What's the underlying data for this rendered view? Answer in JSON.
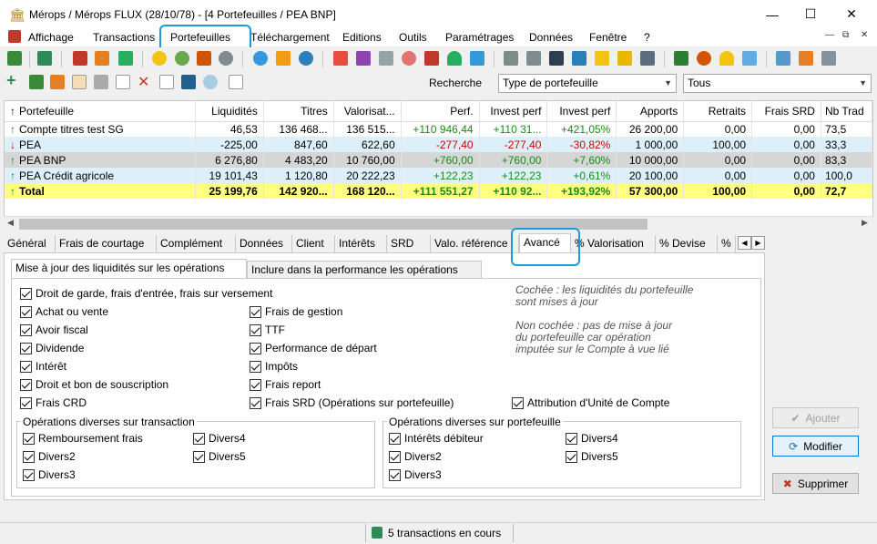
{
  "window": {
    "title": "Mérops / Mérops FLUX (28/10/78) - [4 Portefeuilles / PEA BNP]",
    "minimize": "—",
    "maximize": "☐",
    "close": "✕"
  },
  "menu": {
    "items": [
      "Affichage",
      "Transactions",
      "Portefeuilles",
      "Téléchargement",
      "Editions",
      "Outils",
      "Paramétrages",
      "Données",
      "Fenêtre",
      "?"
    ],
    "active": "Portefeuilles"
  },
  "mdi_controls": [
    "—",
    "⧉",
    "✕"
  ],
  "search": {
    "label": "Recherche",
    "type_value": "Type de portefeuille",
    "filter_value": "Tous"
  },
  "grid": {
    "columns": [
      "Portefeuille",
      "Liquidités",
      "Titres",
      "Valorisat...",
      "Perf.",
      "Invest perf",
      "Invest perf",
      "Apports",
      "Retraits",
      "Frais SRD",
      "Nb Trad"
    ],
    "rows": [
      {
        "arrow": "up",
        "style": "white",
        "cells": [
          "Compte titres test SG",
          "46,53",
          "136 468...",
          "136 515...",
          "+110 946,44",
          "+110 31...",
          "+421,05%",
          "26 200,00",
          "0,00",
          "0,00",
          "73,5"
        ]
      },
      {
        "arrow": "down",
        "style": "blue",
        "cells": [
          "PEA",
          "-225,00",
          "847,60",
          "622,60",
          "-277,40",
          "-277,40",
          "-30,82%",
          "1 000,00",
          "100,00",
          "0,00",
          "33,3"
        ]
      },
      {
        "arrow": "up",
        "style": "gray",
        "cells": [
          "PEA BNP",
          "6 276,80",
          "4 483,20",
          "10 760,00",
          "+760,00",
          "+760,00",
          "+7,60%",
          "10 000,00",
          "0,00",
          "0,00",
          "83,3"
        ]
      },
      {
        "arrow": "up",
        "style": "blue",
        "cells": [
          "PEA Crédit agricole",
          "19 101,43",
          "1 120,80",
          "20 222,23",
          "+122,23",
          "+122,23",
          "+0,61%",
          "20 100,00",
          "0,00",
          "0,00",
          "100,0"
        ]
      },
      {
        "arrow": "up",
        "style": "yellow",
        "cells": [
          "Total",
          "25 199,76",
          "142 920...",
          "168 120...",
          "+111 551,27",
          "+110 92...",
          "+193,92%",
          "57 300,00",
          "100,00",
          "0,00",
          "72,7"
        ]
      }
    ]
  },
  "tabs": [
    "Général",
    "Frais de courtage",
    "Complément",
    "Données",
    "Client",
    "Intérêts",
    "SRD",
    "Valo. référence",
    "Avancé",
    "% Valorisation",
    "% Devise",
    "%"
  ],
  "active_tab": "Avancé",
  "subtabs": [
    "Mise à jour des liquidités sur les opérations",
    "Inclure dans la performance les opérations"
  ],
  "active_subtab": "Mise à jour des liquidités sur les opérations",
  "checks_left": [
    "Droit de garde, frais d'entrée, frais sur versement",
    "Achat ou vente",
    "Avoir fiscal",
    "Dividende",
    "Intérêt",
    "Droit et bon de souscription",
    "Frais CRD"
  ],
  "checks_right": [
    "Frais de gestion",
    "TTF",
    "Performance de départ",
    "Impôts",
    "Frais report",
    "Frais SRD (Opérations sur portefeuille)"
  ],
  "check_extra": "Attribution d'Unité de Compte",
  "note1": [
    "Cochée : les liquidités du portefeuille",
    "sont mises à jour"
  ],
  "note2": [
    "Non cochée : pas de mise à jour",
    "du portefeuille car opération",
    "imputée sur le Compte à vue lié"
  ],
  "group_transaction": {
    "title": "Opérations diverses sur transaction",
    "col1": [
      "Remboursement frais",
      "Divers2",
      "Divers3"
    ],
    "col2": [
      "Divers4",
      "Divers5"
    ]
  },
  "group_portefeuille": {
    "title": "Opérations diverses sur portefeuille",
    "col1": [
      "Intérêts débiteur",
      "Divers2",
      "Divers3"
    ],
    "col2": [
      "Divers4",
      "Divers5"
    ]
  },
  "buttons": {
    "add": "Ajouter",
    "modify": "Modifier",
    "delete": "Supprimer"
  },
  "status": "5 transactions en cours",
  "colors": {
    "highlight": "#1e9ad6",
    "positive": "#1a8a1a",
    "negative": "#d00000",
    "total_row": "#ffff80"
  }
}
